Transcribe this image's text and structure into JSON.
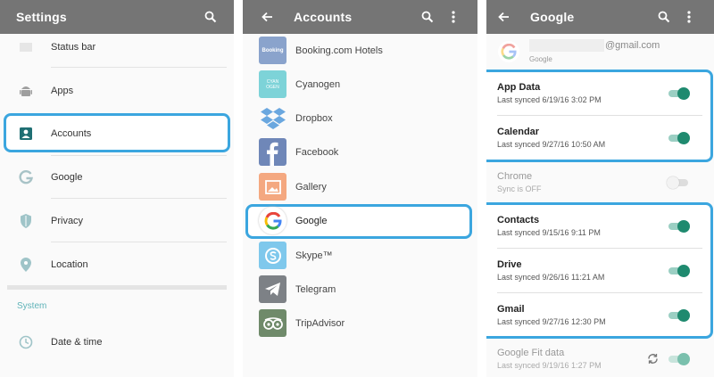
{
  "settings": {
    "title": "Settings",
    "items": [
      {
        "label": "Status bar",
        "icon": "status-bar-icon"
      },
      {
        "label": "Apps",
        "icon": "android-icon"
      },
      {
        "label": "Accounts",
        "icon": "account-icon"
      },
      {
        "label": "Google",
        "icon": "google-g-icon"
      },
      {
        "label": "Privacy",
        "icon": "shield-icon"
      },
      {
        "label": "Location",
        "icon": "location-pin-icon"
      }
    ],
    "section_header": "System",
    "system_items": [
      {
        "label": "Date & time",
        "icon": "clock-icon"
      }
    ]
  },
  "accounts": {
    "title": "Accounts",
    "items": [
      {
        "label": "Booking.com Hotels",
        "icon": "booking-icon",
        "icon_text": "Booking"
      },
      {
        "label": "Cyanogen",
        "icon": "cyanogen-icon",
        "icon_text": "CYAN OGEN"
      },
      {
        "label": "Dropbox",
        "icon": "dropbox-icon"
      },
      {
        "label": "Facebook",
        "icon": "facebook-icon"
      },
      {
        "label": "Gallery",
        "icon": "gallery-icon"
      },
      {
        "label": "Google",
        "icon": "google-g-icon"
      },
      {
        "label": "Skype™",
        "icon": "skype-icon"
      },
      {
        "label": "Telegram",
        "icon": "telegram-icon"
      },
      {
        "label": "TripAdvisor",
        "icon": "tripadvisor-icon"
      }
    ]
  },
  "google": {
    "title": "Google",
    "account_email": "@gmail.com",
    "account_type": "Google",
    "sync_items": [
      {
        "title": "App Data",
        "subtitle": "Last synced 6/19/16 3:02 PM",
        "enabled": true
      },
      {
        "title": "Calendar",
        "subtitle": "Last synced 9/27/16 10:50 AM",
        "enabled": true
      },
      {
        "title": "Chrome",
        "subtitle": "Sync is OFF",
        "enabled": false
      },
      {
        "title": "Contacts",
        "subtitle": "Last synced 9/15/16 9:11 PM",
        "enabled": true
      },
      {
        "title": "Drive",
        "subtitle": "Last synced 9/26/16 11:21 AM",
        "enabled": true
      },
      {
        "title": "Gmail",
        "subtitle": "Last synced 9/27/16 12:30 PM",
        "enabled": true
      },
      {
        "title": "Google Fit data",
        "subtitle": "Last synced 9/19/16 1:27 PM",
        "enabled": true
      }
    ]
  },
  "colors": {
    "appbar": "#757575",
    "highlight": "#3ba6df",
    "toggle_on": "#1f8a6f"
  }
}
